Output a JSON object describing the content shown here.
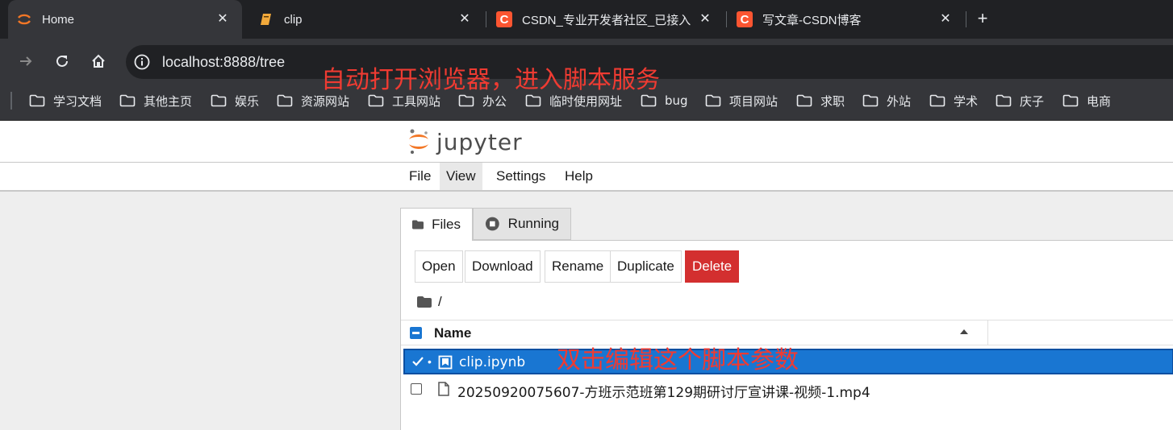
{
  "browser": {
    "tabs": [
      {
        "title": "Home",
        "favicon": "jupyter-icon",
        "active": true
      },
      {
        "title": "clip",
        "favicon": "notebook-icon",
        "active": false
      },
      {
        "title": "CSDN_专业开发者社区_已接入",
        "favicon": "csdn-icon",
        "active": false
      },
      {
        "title": "写文章-CSDN博客",
        "favicon": "csdn-icon",
        "active": false
      }
    ],
    "close_glyph": "✕",
    "new_tab_glyph": "+",
    "address": "localhost:8888/tree",
    "bookmarks": [
      "学习文档",
      "其他主页",
      "娱乐",
      "资源网站",
      "工具网站",
      "办公",
      "临时使用网址",
      "bug",
      "项目网站",
      "求职",
      "外站",
      "学术",
      "庆子",
      "电商"
    ]
  },
  "annotations": {
    "top": "自动打开浏览器，进入脚本服务",
    "row": "双击编辑这个脚本参数"
  },
  "jupyter": {
    "logo_text": "jupyter",
    "menu": [
      "File",
      "View",
      "Settings",
      "Help"
    ],
    "tabs": {
      "files": "Files",
      "running": "Running"
    },
    "actions": {
      "open": "Open",
      "download": "Download",
      "rename": "Rename",
      "duplicate": "Duplicate",
      "delete": "Delete"
    },
    "breadcrumb": "/",
    "column_name": "Name",
    "files": [
      {
        "name": "clip.ipynb",
        "selected": true,
        "running": true
      },
      {
        "name": "20250920075607-方班示范班第129期研讨厅宣讲课-视频-1.mp4",
        "selected": false,
        "running": false
      }
    ]
  },
  "colors": {
    "accent": "#1976d2",
    "danger": "#d32f2f",
    "annotation": "#ef3b32",
    "jupyter_orange": "#f37726"
  }
}
